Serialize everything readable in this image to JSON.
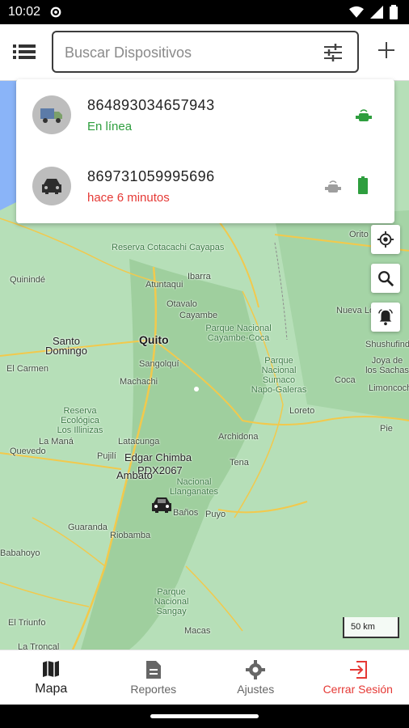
{
  "status_bar": {
    "time": "10:02",
    "icons": [
      "gear-icon",
      "wifi-icon",
      "signal-icon",
      "battery-icon"
    ]
  },
  "app_bar": {
    "search_placeholder": "Buscar Dispositivos",
    "icons": [
      "list-icon",
      "filter-icon",
      "add-icon"
    ]
  },
  "devices": [
    {
      "id": "864893034657943",
      "status": "En línea",
      "status_color": "#2e9e3e",
      "avatar_icon": "truck-icon",
      "indicators": [
        "online-signal-icon"
      ]
    },
    {
      "id": "869731059995696",
      "status": "hace 6 minutos",
      "status_color": "#e53935",
      "avatar_icon": "car-icon",
      "indicators": [
        "offline-signal-icon",
        "battery-full-icon"
      ]
    }
  ],
  "map": {
    "labels": {
      "reserva_cotacachi": "Reserva Cotacachi Cayapas",
      "atuntaqui": "Atuntaqui",
      "ibarra": "Ibarra",
      "otavalo": "Otavalo",
      "cayambe": "Cayambe",
      "quininde": "Quinindé",
      "santo_domingo": "Santo Domingo",
      "quito": "Quito",
      "sangolqui": "Sangolquí",
      "el_carmen": "El Carmen",
      "machachi": "Machachi",
      "parque_cayambe": "Parque Nacional Cayambe-Coca",
      "parque_sumaco": "Parque Nacional Sumaco Napo-Galeras",
      "reserva_iliniza": "Reserva Ecológica Los Illinizas",
      "la_mana": "La Maná",
      "quevedo": "Quevedo",
      "latacunga": "Latacunga",
      "pujili": "Pujilí",
      "edgar": "Edgar Chimba",
      "pdx": "PDX2067",
      "ambato": "Ambato",
      "llanganates": "Nacional Llanganates",
      "archidona": "Archidona",
      "tena": "Tena",
      "loreto": "Loreto",
      "coca": "Coca",
      "shushufindi": "Shushufindi",
      "sachas": "Joya de los Sachas",
      "limoncocha": "Limoncocha",
      "nueva_loja": "Nueva Lo",
      "orito": "Orito",
      "guaranda": "Guaranda",
      "riobamba": "Riobamba",
      "banos": "Baños",
      "puyo": "Puyo",
      "babahoyo": "Babahoyo",
      "sangay": "Parque Nacional Sangay",
      "el_triunfo": "El Triunfo",
      "la_troncal": "La Troncal",
      "macas": "Macas",
      "pie": "Pie"
    },
    "scale": "50 km",
    "controls": [
      "my-location-icon",
      "search-icon",
      "alarm-icon"
    ]
  },
  "bottom_nav": {
    "items": [
      {
        "label": "Mapa",
        "icon": "map-icon",
        "active": true
      },
      {
        "label": "Reportes",
        "icon": "report-icon",
        "active": false
      },
      {
        "label": "Ajustes",
        "icon": "settings-icon",
        "active": false
      },
      {
        "label": "Cerrar Sesión",
        "icon": "logout-icon",
        "active": false
      }
    ]
  },
  "colors": {
    "online": "#2e9e3e",
    "offline": "#e53935",
    "map_green": "#aadbb0"
  }
}
